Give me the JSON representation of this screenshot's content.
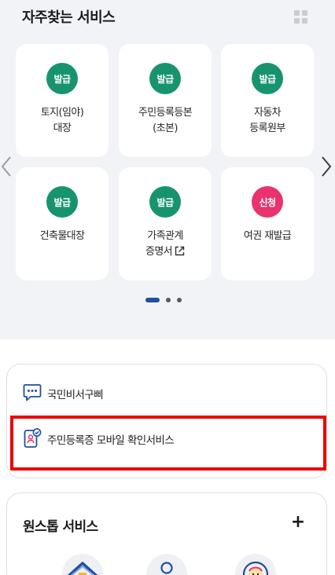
{
  "frequent_services": {
    "title": "자주찾는 서비스",
    "view_toggle_icon": "grid-icon",
    "cards": [
      {
        "badge": "발급",
        "badge_color": "#17946e",
        "lines": [
          "토지(임야)",
          "대장"
        ]
      },
      {
        "badge": "발급",
        "badge_color": "#17946e",
        "lines": [
          "주민등록등본",
          "(초본)"
        ]
      },
      {
        "badge": "발급",
        "badge_color": "#17946e",
        "lines": [
          "자동차",
          "등록원부"
        ]
      },
      {
        "badge": "발급",
        "badge_color": "#17946e",
        "lines": [
          "건축물대장",
          ""
        ]
      },
      {
        "badge": "발급",
        "badge_color": "#17946e",
        "lines": [
          "가족관계",
          "증명서"
        ],
        "external_link_icon": "external-link-icon"
      },
      {
        "badge": "신청",
        "badge_color": "#e8336e",
        "lines": [
          "여권 재발급",
          ""
        ]
      }
    ],
    "pagination": {
      "total": 3,
      "active": 1
    },
    "prev_icon": "chevron-left-icon",
    "next_icon": "chevron-right-icon"
  },
  "services": [
    {
      "label": "국민비서구삐",
      "icon": "chat-bubble-icon"
    },
    {
      "label": "주민등록증 모바일 확인서비스",
      "icon": "mobile-id-icon"
    }
  ],
  "highlight_color": "#ec0000",
  "onestop": {
    "title": "원스톱 서비스",
    "expand_label": "+",
    "icons": [
      "house-icon",
      "person-icon",
      "baby-icon"
    ]
  }
}
